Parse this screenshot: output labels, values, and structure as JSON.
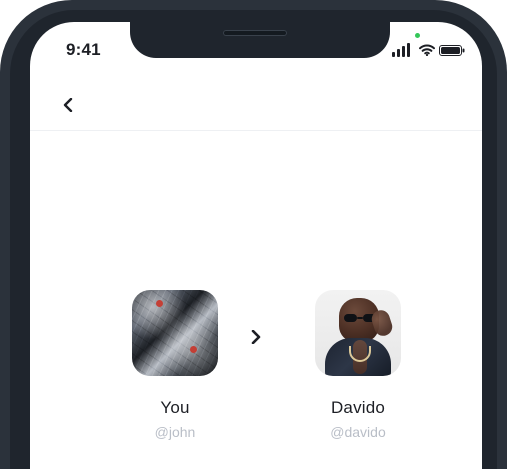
{
  "status_bar": {
    "time": "9:41"
  },
  "header": {
    "back_icon": "chevron-left-icon"
  },
  "transfer": {
    "from": {
      "name": "You",
      "handle": "@john"
    },
    "to": {
      "name": "Davido",
      "handle": "@davido"
    },
    "arrow_icon": "chevron-right-icon"
  },
  "colors": {
    "frame": "#2b323b",
    "text_primary": "#1d1f25",
    "text_secondary": "#b9bec7",
    "status_green": "#34c759"
  }
}
